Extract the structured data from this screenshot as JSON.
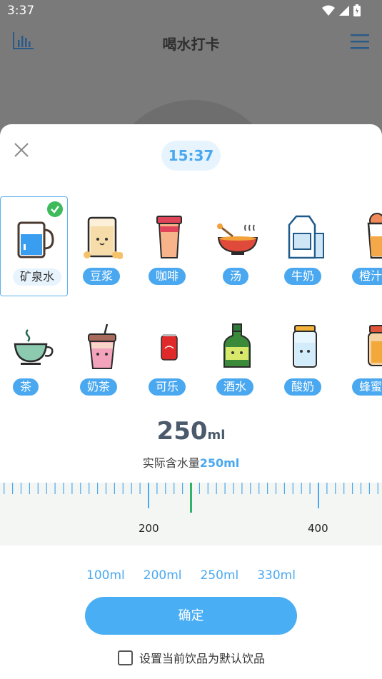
{
  "status_bar": {
    "time": "3:37"
  },
  "header": {
    "title": "喝水打卡"
  },
  "sheet": {
    "time": "15:37",
    "drinks_row1": [
      {
        "label": "矿泉水",
        "icon": "mineral-water-icon",
        "selected": true
      },
      {
        "label": "豆浆",
        "icon": "soy-milk-icon"
      },
      {
        "label": "咖啡",
        "icon": "coffee-icon"
      },
      {
        "label": "汤",
        "icon": "soup-icon"
      },
      {
        "label": "牛奶",
        "icon": "milk-icon"
      },
      {
        "label": "橙汁",
        "icon": "orange-juice-icon"
      }
    ],
    "drinks_row2": [
      {
        "label": "茶",
        "icon": "tea-icon"
      },
      {
        "label": "奶茶",
        "icon": "milk-tea-icon"
      },
      {
        "label": "可乐",
        "icon": "cola-icon"
      },
      {
        "label": "酒水",
        "icon": "liquor-icon"
      },
      {
        "label": "酸奶",
        "icon": "yogurt-icon"
      },
      {
        "label": "蜂蜜水",
        "icon": "honey-water-icon"
      }
    ],
    "amount_value": "250",
    "amount_unit": "ml",
    "actual_label": "实际含水量",
    "actual_value": "250ml",
    "ruler": {
      "labels": [
        "200",
        "400"
      ],
      "current": 250
    },
    "quick_amounts": [
      "100ml",
      "200ml",
      "250ml",
      "330ml"
    ],
    "confirm_label": "确定",
    "default_label": "设置当前饮品为默认饮品"
  },
  "colors": {
    "accent": "#4aa8f0",
    "check": "#3dbb5c",
    "ruler_pointer": "#2fb36a"
  }
}
